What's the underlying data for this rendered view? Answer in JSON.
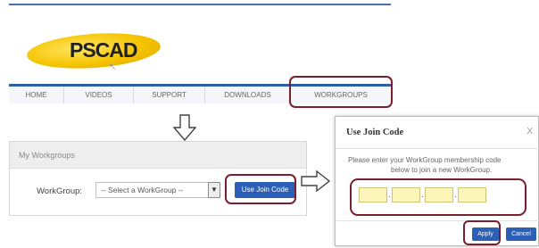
{
  "site": {
    "logo_text": "PSCAD",
    "nav": [
      "HOME",
      "VIDEOS",
      "SUPPORT",
      "DOWNLOADS",
      "WORKGROUPS"
    ]
  },
  "my_workgroups": {
    "title": "My Workgroups",
    "workgroup_label": "WorkGroup:",
    "select_value": "-- Select a WorkGroup --",
    "join_button": "Use Join Code"
  },
  "dialog": {
    "title": "Use Join Code",
    "close": "X",
    "message_line1": "Please enter your WorkGroup membership code",
    "message_line2": "below to join a new WorkGroup.",
    "code_fields": [
      "",
      "",
      "",
      ""
    ],
    "separator": ".",
    "apply_button": "Apply",
    "cancel_button": "Cancel"
  },
  "colors": {
    "highlight": "#7a1f2b",
    "primary_button": "#2b5fb8",
    "code_field_fill": "#fdf6b8",
    "logo_yellow": "#f5c400"
  }
}
